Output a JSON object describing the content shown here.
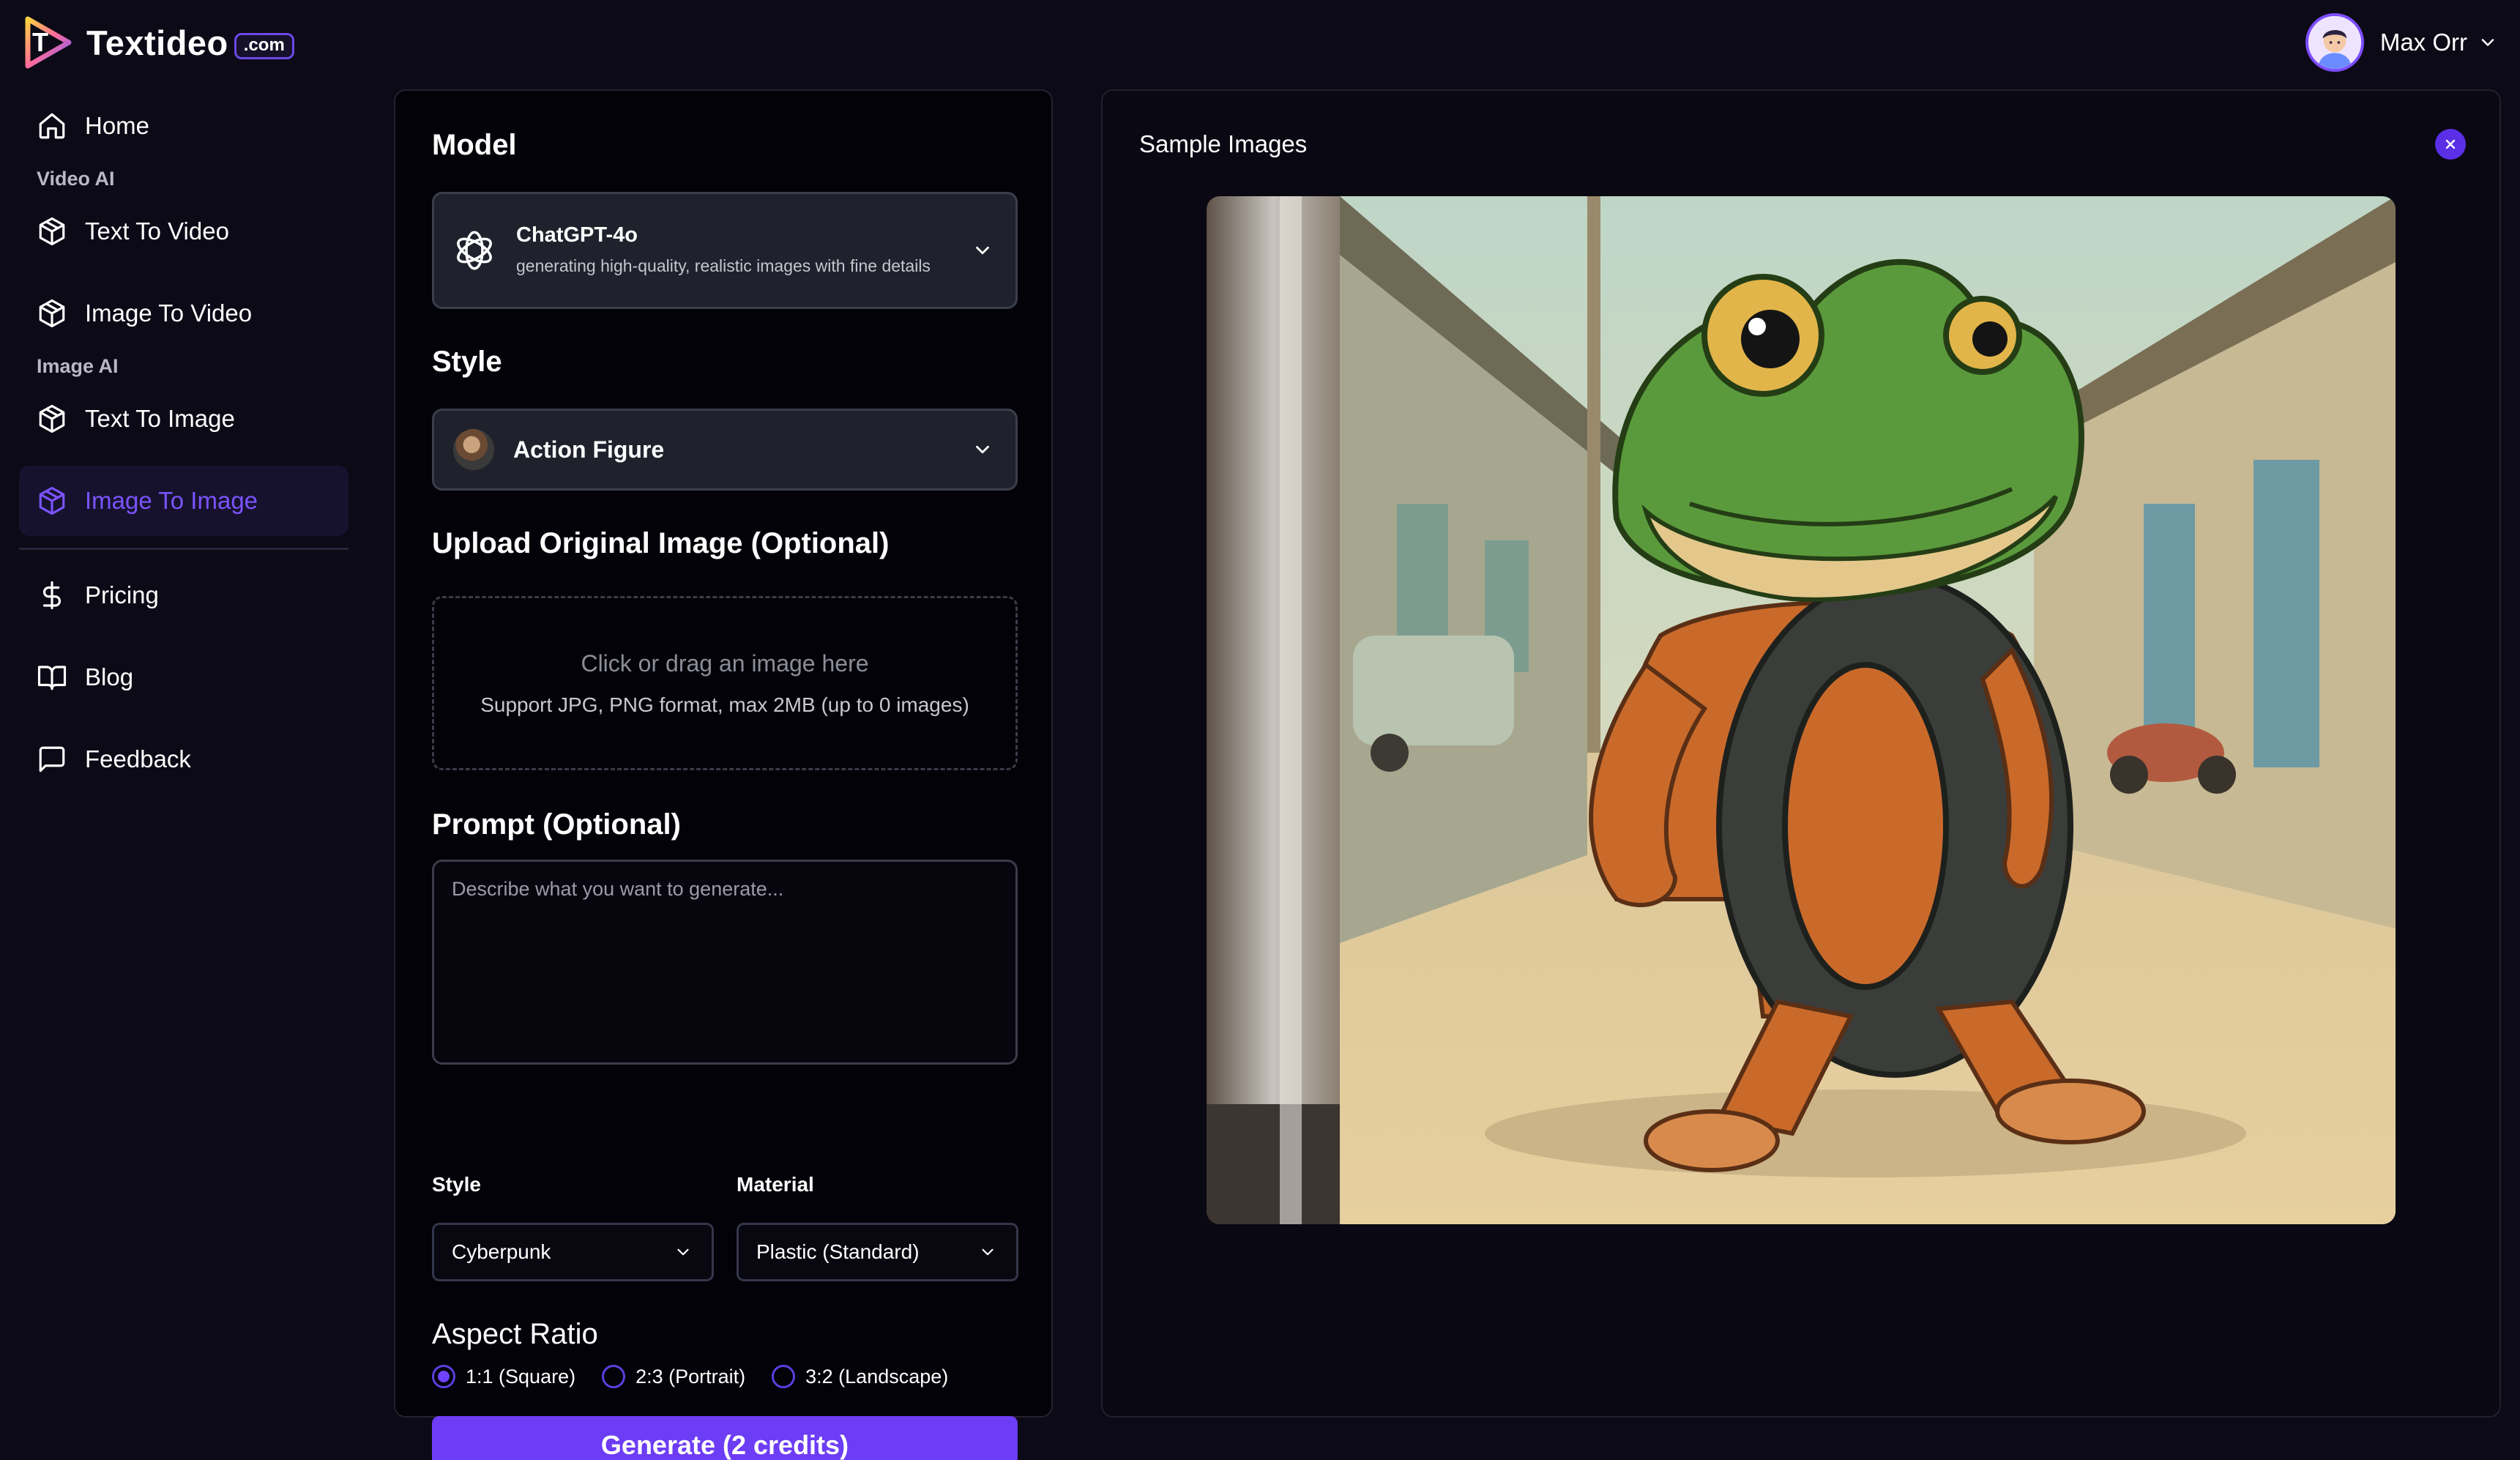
{
  "brand": {
    "name": "Textideo",
    "tld": ".com"
  },
  "user": {
    "name": "Max Orr"
  },
  "sidebar": {
    "home": "Home",
    "video_section": "Video AI",
    "text_to_video": "Text To Video",
    "image_to_video": "Image To Video",
    "image_section": "Image AI",
    "text_to_image": "Text To Image",
    "image_to_image": "Image To Image",
    "pricing": "Pricing",
    "blog": "Blog",
    "feedback": "Feedback"
  },
  "form": {
    "model_title": "Model",
    "model": {
      "name": "ChatGPT-4o",
      "description": "generating high-quality, realistic images with fine details"
    },
    "style_title": "Style",
    "style": {
      "name": "Action Figure"
    },
    "upload_title": "Upload Original Image (Optional)",
    "upload_main": "Click or drag an image here",
    "upload_sub": "Support JPG, PNG format, max 2MB (up to 0 images)",
    "prompt_title": "Prompt (Optional)",
    "prompt_placeholder": "Describe what you want to generate...",
    "style_label": "Style",
    "style_value": "Cyberpunk",
    "material_label": "Material",
    "material_value": "Plastic (Standard)",
    "aspect_title": "Aspect Ratio",
    "aspect_options": [
      "1:1 (Square)",
      "2:3 (Portrait)",
      "3:2 (Landscape)"
    ],
    "aspect_selected": "1:1 (Square)",
    "generate_label": "Generate (2 credits)"
  },
  "sample": {
    "title": "Sample Images"
  },
  "colors": {
    "accent": "#6d3cf5",
    "active_nav_text": "#7b53ff",
    "background": "#0c0a16"
  },
  "icons": {
    "home": "home-icon",
    "cube": "cube-icon",
    "dollar": "dollar-icon",
    "book": "book-icon",
    "message": "message-square-icon",
    "chevron": "chevron-down-icon",
    "close": "close-icon",
    "openai": "openai-logo-icon"
  }
}
